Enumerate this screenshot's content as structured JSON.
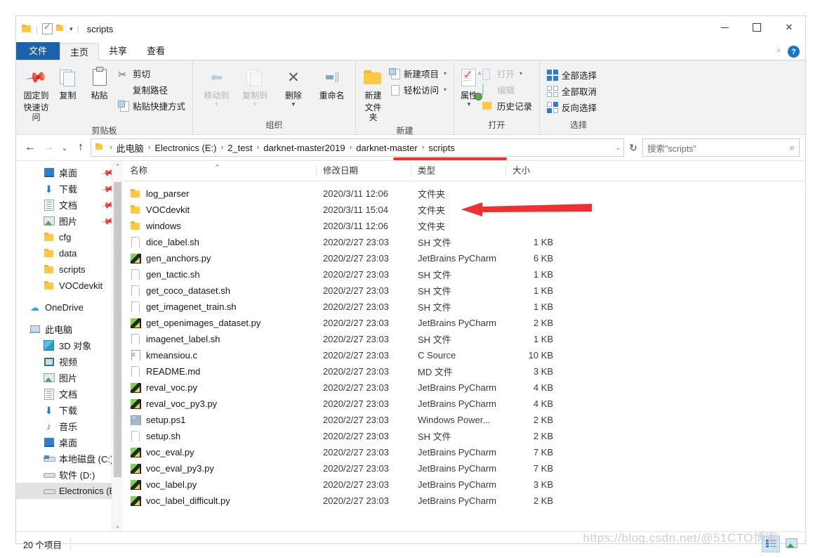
{
  "window": {
    "title": "scripts",
    "quick_access": [
      "folder-icon",
      "properties-check-icon",
      "folder-icon",
      "dropdown-caret-icon"
    ],
    "controls": {
      "minimize": "–",
      "maximize": "□",
      "close": "✕"
    },
    "ribbon_collapse": "^",
    "help": "?"
  },
  "tabs": [
    {
      "label": "文件",
      "name": "tab-file"
    },
    {
      "label": "主页",
      "name": "tab-home"
    },
    {
      "label": "共享",
      "name": "tab-share"
    },
    {
      "label": "查看",
      "name": "tab-view"
    }
  ],
  "ribbon": {
    "groups": [
      {
        "label": "剪贴板",
        "big": [
          {
            "label_line1": "固定到",
            "label_line2": "快速访问",
            "icon": "pin-icon"
          },
          {
            "label_line1": "复制",
            "label_line2": "",
            "icon": "copy-icon"
          },
          {
            "label_line1": "粘贴",
            "label_line2": "",
            "icon": "paste-icon"
          }
        ],
        "small": [
          {
            "label": "剪切",
            "icon": "scissors-icon"
          },
          {
            "label": "复制路径",
            "icon": "copy-path-icon"
          },
          {
            "label": "粘贴快捷方式",
            "icon": "paste-shortcut-icon"
          }
        ]
      },
      {
        "label": "组织",
        "big": [
          {
            "label_line1": "移动到",
            "label_line2": "",
            "icon": "move-to-icon",
            "dim": true
          },
          {
            "label_line1": "复制到",
            "label_line2": "",
            "icon": "copy-to-icon",
            "dim": true
          },
          {
            "label_line1": "删除",
            "label_line2": "",
            "icon": "delete-icon"
          },
          {
            "label_line1": "重命名",
            "label_line2": "",
            "icon": "rename-icon"
          }
        ],
        "small": []
      },
      {
        "label": "新建",
        "big": [
          {
            "label_line1": "新建",
            "label_line2": "文件夹",
            "icon": "new-folder-icon"
          }
        ],
        "small": [
          {
            "label": "新建项目",
            "icon": "new-item-icon",
            "dropdown": true
          },
          {
            "label": "轻松访问",
            "icon": "easy-access-icon",
            "dropdown": true
          }
        ]
      },
      {
        "label": "打开",
        "big": [
          {
            "label_line1": "属性",
            "label_line2": "",
            "icon": "properties-icon"
          }
        ],
        "small": [
          {
            "label": "打开",
            "icon": "open-icon",
            "dropdown": true,
            "dim": true
          },
          {
            "label": "编辑",
            "icon": "edit-icon",
            "dim": true
          },
          {
            "label": "历史记录",
            "icon": "history-icon"
          }
        ]
      },
      {
        "label": "选择",
        "big": [],
        "small": [
          {
            "label": "全部选择",
            "icon": "select-all-icon"
          },
          {
            "label": "全部取消",
            "icon": "select-none-icon"
          },
          {
            "label": "反向选择",
            "icon": "invert-selection-icon"
          }
        ]
      }
    ]
  },
  "addressbar": {
    "back": "←",
    "forward": "→",
    "history": "⌄",
    "up": "↑",
    "crumbs": [
      "此电脑",
      "Electronics (E:)",
      "2_test",
      "darknet-master2019",
      "darknet-master",
      "scripts"
    ],
    "dropdown": "⌄",
    "refresh": "↻",
    "search_placeholder": "搜索\"scripts\""
  },
  "sidebar": {
    "items": [
      {
        "label": "桌面",
        "icon": "desktop-icon",
        "pinned": true,
        "indent": true
      },
      {
        "label": "下载",
        "icon": "downloads-icon",
        "pinned": true,
        "indent": true
      },
      {
        "label": "文档",
        "icon": "documents-icon",
        "pinned": true,
        "indent": true
      },
      {
        "label": "图片",
        "icon": "pictures-icon",
        "pinned": true,
        "indent": true
      },
      {
        "label": "cfg",
        "icon": "folder-icon",
        "pinned": false,
        "indent": true
      },
      {
        "label": "data",
        "icon": "folder-icon",
        "pinned": false,
        "indent": true
      },
      {
        "label": "scripts",
        "icon": "folder-icon",
        "pinned": false,
        "indent": true
      },
      {
        "label": "VOCdevkit",
        "icon": "folder-icon",
        "pinned": false,
        "indent": true
      },
      {
        "label": "OneDrive",
        "icon": "onedrive-cloud-icon",
        "pinned": false,
        "indent": false
      },
      {
        "label": "此电脑",
        "icon": "this-pc-icon",
        "pinned": false,
        "indent": false
      },
      {
        "label": "3D 对象",
        "icon": "3d-objects-icon",
        "pinned": false,
        "indent": true
      },
      {
        "label": "视频",
        "icon": "videos-icon",
        "pinned": false,
        "indent": true
      },
      {
        "label": "图片",
        "icon": "pictures-icon",
        "pinned": false,
        "indent": true
      },
      {
        "label": "文档",
        "icon": "documents-icon",
        "pinned": false,
        "indent": true
      },
      {
        "label": "下载",
        "icon": "downloads-icon",
        "pinned": false,
        "indent": true
      },
      {
        "label": "音乐",
        "icon": "music-icon",
        "pinned": false,
        "indent": true
      },
      {
        "label": "桌面",
        "icon": "desktop-icon",
        "pinned": false,
        "indent": true
      },
      {
        "label": "本地磁盘 (C:)",
        "icon": "system-drive-icon",
        "pinned": false,
        "indent": true
      },
      {
        "label": "软件 (D:)",
        "icon": "drive-icon",
        "pinned": false,
        "indent": true
      },
      {
        "label": "Electronics (E:",
        "icon": "drive-icon",
        "pinned": false,
        "indent": true,
        "selected": true
      }
    ],
    "scroll_up": "⌃",
    "scroll_down": "⌄"
  },
  "filelist": {
    "columns": [
      "名称",
      "修改日期",
      "类型",
      "大小"
    ],
    "sort_indicator": "⌃",
    "rows": [
      {
        "name": "log_parser",
        "date": "2020/3/11 12:06",
        "type": "文件夹",
        "size": "",
        "icon": "folder-icon"
      },
      {
        "name": "VOCdevkit",
        "date": "2020/3/11 15:04",
        "type": "文件夹",
        "size": "",
        "icon": "folder-icon"
      },
      {
        "name": "windows",
        "date": "2020/3/11 12:06",
        "type": "文件夹",
        "size": "",
        "icon": "folder-icon"
      },
      {
        "name": "dice_label.sh",
        "date": "2020/2/27 23:03",
        "type": "SH 文件",
        "size": "1 KB",
        "icon": "file-icon"
      },
      {
        "name": "gen_anchors.py",
        "date": "2020/2/27 23:03",
        "type": "JetBrains PyCharm",
        "size": "6 KB",
        "icon": "pycharm-icon"
      },
      {
        "name": "gen_tactic.sh",
        "date": "2020/2/27 23:03",
        "type": "SH 文件",
        "size": "1 KB",
        "icon": "file-icon"
      },
      {
        "name": "get_coco_dataset.sh",
        "date": "2020/2/27 23:03",
        "type": "SH 文件",
        "size": "1 KB",
        "icon": "file-icon"
      },
      {
        "name": "get_imagenet_train.sh",
        "date": "2020/2/27 23:03",
        "type": "SH 文件",
        "size": "1 KB",
        "icon": "file-icon"
      },
      {
        "name": "get_openimages_dataset.py",
        "date": "2020/2/27 23:03",
        "type": "JetBrains PyCharm",
        "size": "2 KB",
        "icon": "pycharm-icon"
      },
      {
        "name": "imagenet_label.sh",
        "date": "2020/2/27 23:03",
        "type": "SH 文件",
        "size": "1 KB",
        "icon": "file-icon"
      },
      {
        "name": "kmeansiou.c",
        "date": "2020/2/27 23:03",
        "type": "C Source",
        "size": "10 KB",
        "icon": "c-source-icon"
      },
      {
        "name": "README.md",
        "date": "2020/2/27 23:03",
        "type": "MD 文件",
        "size": "3 KB",
        "icon": "file-icon"
      },
      {
        "name": "reval_voc.py",
        "date": "2020/2/27 23:03",
        "type": "JetBrains PyCharm",
        "size": "4 KB",
        "icon": "pycharm-icon"
      },
      {
        "name": "reval_voc_py3.py",
        "date": "2020/2/27 23:03",
        "type": "JetBrains PyCharm",
        "size": "4 KB",
        "icon": "pycharm-icon"
      },
      {
        "name": "setup.ps1",
        "date": "2020/2/27 23:03",
        "type": "Windows Power...",
        "size": "2 KB",
        "icon": "powershell-icon"
      },
      {
        "name": "setup.sh",
        "date": "2020/2/27 23:03",
        "type": "SH 文件",
        "size": "2 KB",
        "icon": "file-icon"
      },
      {
        "name": "voc_eval.py",
        "date": "2020/2/27 23:03",
        "type": "JetBrains PyCharm",
        "size": "7 KB",
        "icon": "pycharm-icon"
      },
      {
        "name": "voc_eval_py3.py",
        "date": "2020/2/27 23:03",
        "type": "JetBrains PyCharm",
        "size": "7 KB",
        "icon": "pycharm-icon"
      },
      {
        "name": "voc_label.py",
        "date": "2020/2/27 23:03",
        "type": "JetBrains PyCharm",
        "size": "3 KB",
        "icon": "pycharm-icon"
      },
      {
        "name": "voc_label_difficult.py",
        "date": "2020/2/27 23:03",
        "type": "JetBrains PyCharm",
        "size": "2 KB",
        "icon": "pycharm-icon"
      }
    ]
  },
  "status": {
    "item_count": "20 个项目",
    "view_details": "details-view-icon",
    "view_thumbnails": "thumbnail-view-icon"
  },
  "annotations": {
    "arrow_color": "#f03030",
    "underline_color": "#f03030",
    "watermark": "https://blog.csdn.net/@51CTO博客"
  }
}
